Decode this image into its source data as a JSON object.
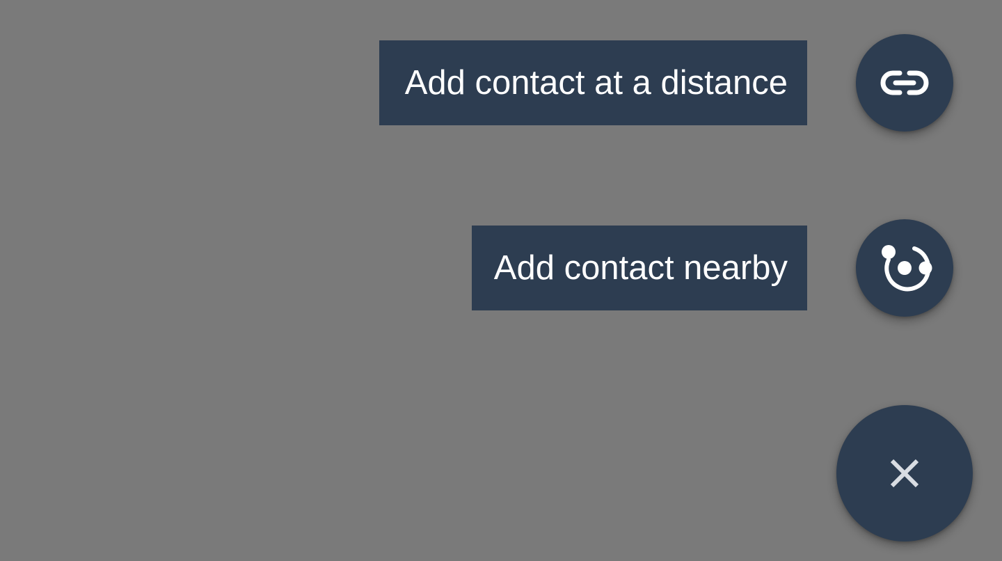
{
  "speed_dial": {
    "actions": [
      {
        "label": "Add contact at a distance",
        "icon": "link-icon"
      },
      {
        "label": "Add contact nearby",
        "icon": "nearby-icon"
      }
    ],
    "main_button": {
      "icon": "close-icon"
    }
  },
  "colors": {
    "scrim": "#7a7a7a",
    "fab_background": "#2d3d51",
    "label_background": "#2d3d51",
    "label_text": "#ffffff",
    "close_icon": "#d9dde3"
  }
}
